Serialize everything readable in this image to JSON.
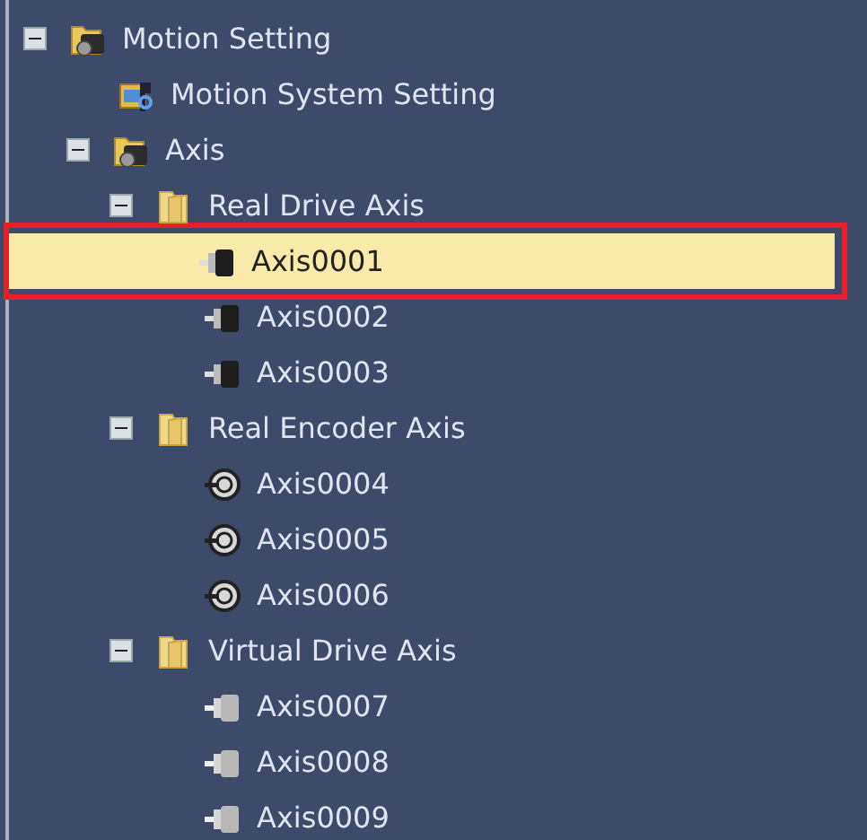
{
  "tree": [
    {
      "label": "Motion Setting",
      "kind": "motion",
      "expanded": true,
      "selected": false,
      "children": [
        {
          "label": "Motion System Setting",
          "kind": "system",
          "selected": false
        },
        {
          "label": "Axis",
          "kind": "motion",
          "expanded": true,
          "selected": false,
          "children": [
            {
              "label": "Real Drive Axis",
              "kind": "folder",
              "expanded": true,
              "selected": false,
              "children": [
                {
                  "label": "Axis0001",
                  "kind": "drive",
                  "selected": true
                },
                {
                  "label": "Axis0002",
                  "kind": "drive",
                  "selected": false
                },
                {
                  "label": "Axis0003",
                  "kind": "drive",
                  "selected": false
                }
              ]
            },
            {
              "label": "Real Encoder Axis",
              "kind": "folder",
              "expanded": true,
              "selected": false,
              "children": [
                {
                  "label": "Axis0004",
                  "kind": "encoder",
                  "selected": false
                },
                {
                  "label": "Axis0005",
                  "kind": "encoder",
                  "selected": false
                },
                {
                  "label": "Axis0006",
                  "kind": "encoder",
                  "selected": false
                }
              ]
            },
            {
              "label": "Virtual Drive Axis",
              "kind": "folder",
              "expanded": true,
              "selected": false,
              "children": [
                {
                  "label": "Axis0007",
                  "kind": "virtual",
                  "selected": false
                },
                {
                  "label": "Axis0008",
                  "kind": "virtual",
                  "selected": false
                },
                {
                  "label": "Axis0009",
                  "kind": "virtual",
                  "selected": false
                }
              ]
            }
          ]
        }
      ]
    }
  ]
}
